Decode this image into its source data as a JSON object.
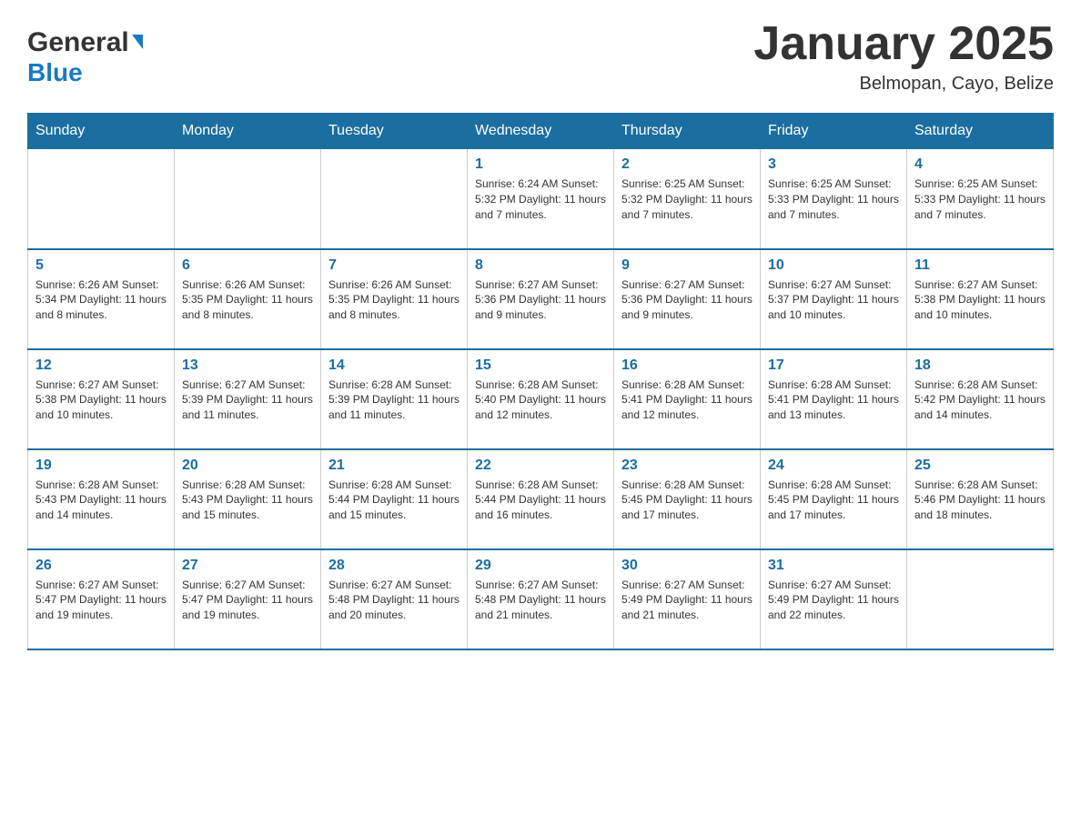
{
  "logo": {
    "line1": "General",
    "triangle": "▶",
    "line2": "Blue"
  },
  "title": "January 2025",
  "subtitle": "Belmopan, Cayo, Belize",
  "headers": [
    "Sunday",
    "Monday",
    "Tuesday",
    "Wednesday",
    "Thursday",
    "Friday",
    "Saturday"
  ],
  "weeks": [
    [
      {
        "day": "",
        "info": ""
      },
      {
        "day": "",
        "info": ""
      },
      {
        "day": "",
        "info": ""
      },
      {
        "day": "1",
        "info": "Sunrise: 6:24 AM\nSunset: 5:32 PM\nDaylight: 11 hours and 7 minutes."
      },
      {
        "day": "2",
        "info": "Sunrise: 6:25 AM\nSunset: 5:32 PM\nDaylight: 11 hours and 7 minutes."
      },
      {
        "day": "3",
        "info": "Sunrise: 6:25 AM\nSunset: 5:33 PM\nDaylight: 11 hours and 7 minutes."
      },
      {
        "day": "4",
        "info": "Sunrise: 6:25 AM\nSunset: 5:33 PM\nDaylight: 11 hours and 7 minutes."
      }
    ],
    [
      {
        "day": "5",
        "info": "Sunrise: 6:26 AM\nSunset: 5:34 PM\nDaylight: 11 hours and 8 minutes."
      },
      {
        "day": "6",
        "info": "Sunrise: 6:26 AM\nSunset: 5:35 PM\nDaylight: 11 hours and 8 minutes."
      },
      {
        "day": "7",
        "info": "Sunrise: 6:26 AM\nSunset: 5:35 PM\nDaylight: 11 hours and 8 minutes."
      },
      {
        "day": "8",
        "info": "Sunrise: 6:27 AM\nSunset: 5:36 PM\nDaylight: 11 hours and 9 minutes."
      },
      {
        "day": "9",
        "info": "Sunrise: 6:27 AM\nSunset: 5:36 PM\nDaylight: 11 hours and 9 minutes."
      },
      {
        "day": "10",
        "info": "Sunrise: 6:27 AM\nSunset: 5:37 PM\nDaylight: 11 hours and 10 minutes."
      },
      {
        "day": "11",
        "info": "Sunrise: 6:27 AM\nSunset: 5:38 PM\nDaylight: 11 hours and 10 minutes."
      }
    ],
    [
      {
        "day": "12",
        "info": "Sunrise: 6:27 AM\nSunset: 5:38 PM\nDaylight: 11 hours and 10 minutes."
      },
      {
        "day": "13",
        "info": "Sunrise: 6:27 AM\nSunset: 5:39 PM\nDaylight: 11 hours and 11 minutes."
      },
      {
        "day": "14",
        "info": "Sunrise: 6:28 AM\nSunset: 5:39 PM\nDaylight: 11 hours and 11 minutes."
      },
      {
        "day": "15",
        "info": "Sunrise: 6:28 AM\nSunset: 5:40 PM\nDaylight: 11 hours and 12 minutes."
      },
      {
        "day": "16",
        "info": "Sunrise: 6:28 AM\nSunset: 5:41 PM\nDaylight: 11 hours and 12 minutes."
      },
      {
        "day": "17",
        "info": "Sunrise: 6:28 AM\nSunset: 5:41 PM\nDaylight: 11 hours and 13 minutes."
      },
      {
        "day": "18",
        "info": "Sunrise: 6:28 AM\nSunset: 5:42 PM\nDaylight: 11 hours and 14 minutes."
      }
    ],
    [
      {
        "day": "19",
        "info": "Sunrise: 6:28 AM\nSunset: 5:43 PM\nDaylight: 11 hours and 14 minutes."
      },
      {
        "day": "20",
        "info": "Sunrise: 6:28 AM\nSunset: 5:43 PM\nDaylight: 11 hours and 15 minutes."
      },
      {
        "day": "21",
        "info": "Sunrise: 6:28 AM\nSunset: 5:44 PM\nDaylight: 11 hours and 15 minutes."
      },
      {
        "day": "22",
        "info": "Sunrise: 6:28 AM\nSunset: 5:44 PM\nDaylight: 11 hours and 16 minutes."
      },
      {
        "day": "23",
        "info": "Sunrise: 6:28 AM\nSunset: 5:45 PM\nDaylight: 11 hours and 17 minutes."
      },
      {
        "day": "24",
        "info": "Sunrise: 6:28 AM\nSunset: 5:45 PM\nDaylight: 11 hours and 17 minutes."
      },
      {
        "day": "25",
        "info": "Sunrise: 6:28 AM\nSunset: 5:46 PM\nDaylight: 11 hours and 18 minutes."
      }
    ],
    [
      {
        "day": "26",
        "info": "Sunrise: 6:27 AM\nSunset: 5:47 PM\nDaylight: 11 hours and 19 minutes."
      },
      {
        "day": "27",
        "info": "Sunrise: 6:27 AM\nSunset: 5:47 PM\nDaylight: 11 hours and 19 minutes."
      },
      {
        "day": "28",
        "info": "Sunrise: 6:27 AM\nSunset: 5:48 PM\nDaylight: 11 hours and 20 minutes."
      },
      {
        "day": "29",
        "info": "Sunrise: 6:27 AM\nSunset: 5:48 PM\nDaylight: 11 hours and 21 minutes."
      },
      {
        "day": "30",
        "info": "Sunrise: 6:27 AM\nSunset: 5:49 PM\nDaylight: 11 hours and 21 minutes."
      },
      {
        "day": "31",
        "info": "Sunrise: 6:27 AM\nSunset: 5:49 PM\nDaylight: 11 hours and 22 minutes."
      },
      {
        "day": "",
        "info": ""
      }
    ]
  ]
}
